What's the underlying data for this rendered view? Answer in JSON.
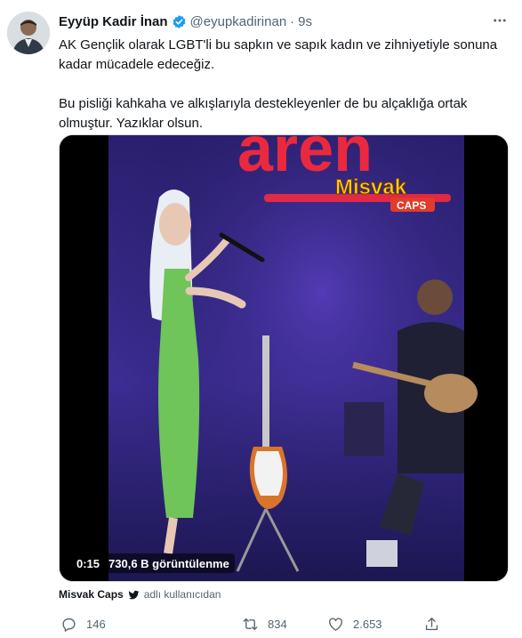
{
  "tweet": {
    "author": {
      "display_name": "Eyyüp Kadir İnan",
      "handle": "@eyupkadirinan",
      "separator": "·",
      "time": "9s",
      "verified": true
    },
    "text": {
      "paragraph1": "AK Gençlik olarak LGBT'li bu sapkın ve sapık kadın ve zihniyetiyle sonuna kadar mücadele edeceğiz.",
      "paragraph2": "Bu pisliği kahkaha ve alkışlarıyla destekleyenler de bu alçaklığa ortak olmuştur. Yazıklar olsun."
    },
    "video": {
      "duration": "0:15",
      "views": "730,6 B görüntülenme",
      "watermark_line1": "Misvak",
      "watermark_line2": "CAPS",
      "sign_text": "aren"
    },
    "attribution": {
      "name": "Misvak Caps",
      "suffix": "adlı kullanıcıdan"
    },
    "actions": {
      "reply_count": "146",
      "retweet_count": "834",
      "like_count": "2.653"
    }
  },
  "colors": {
    "text_primary": "#0f1419",
    "text_secondary": "#536471",
    "verified_blue": "#1d9bf0",
    "stage_purple": "#3a2a8a",
    "neon_red": "#ff2a3a",
    "dress_green": "#6fc45a"
  },
  "icons": [
    "more-icon",
    "verified-badge-icon",
    "twitter-bird-icon",
    "reply-icon",
    "retweet-icon",
    "like-icon",
    "share-icon"
  ]
}
